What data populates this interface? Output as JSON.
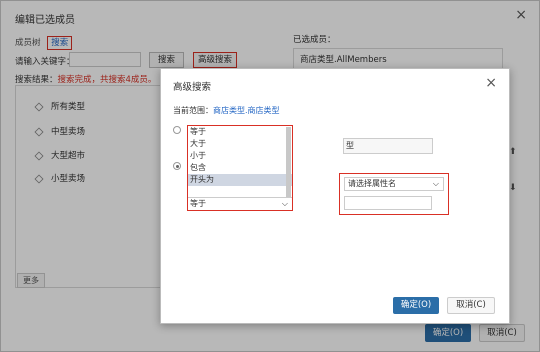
{
  "base": {
    "title": "编辑已选成员",
    "close": "×",
    "tab_tree": "成员树",
    "tab_search": "搜索",
    "keyword_label": "请输入关键字：",
    "btn_search": "搜索",
    "btn_advanced": "高级搜索",
    "result_prefix": "搜索结果：",
    "result_text": "搜索完成，共搜索4成员。",
    "tree_items": [
      "所有类型",
      "中型卖场",
      "大型超市",
      "小型卖场"
    ],
    "more": "更多",
    "selected_label": "已选成员：",
    "selected_items": [
      "商店类型.AllMembers"
    ],
    "up_arrow": "⬆",
    "down_arrow": "⬇",
    "ok": "确定(O)",
    "cancel": "取消(C)"
  },
  "advanced": {
    "title": "高级搜索",
    "close": "×",
    "scope_label": "当前范围：",
    "scope_value": "商店类型.商店类型",
    "operators": [
      "等于",
      "大于",
      "小于",
      "包含",
      "开头为"
    ],
    "selected_operator": "等于",
    "field_value": "型",
    "attr_placeholder": "请选择属性名",
    "chevron": "⌵",
    "ok": "确定(O)",
    "cancel": "取消(C)"
  }
}
